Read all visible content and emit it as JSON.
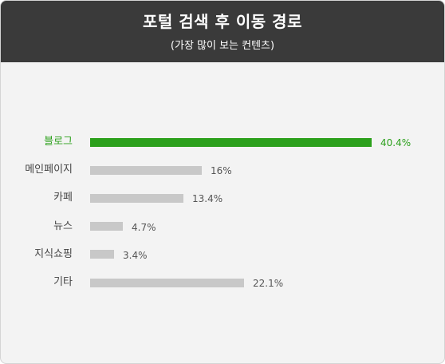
{
  "header": {
    "title": "포털 검색 후 이동 경로",
    "subtitle": "(가장 많이 보는 컨텐츠)"
  },
  "colors": {
    "highlight": "#2ca01c",
    "bar": "#c8c8c8",
    "label": "#444444",
    "value": "#555555"
  },
  "chart_data": {
    "type": "bar",
    "orientation": "horizontal",
    "title": "포털 검색 후 이동 경로",
    "subtitle": "(가장 많이 보는 컨텐츠)",
    "categories": [
      "블로그",
      "메인페이지",
      "카페",
      "뉴스",
      "지식쇼핑",
      "기타"
    ],
    "values": [
      40.4,
      16,
      13.4,
      4.7,
      3.4,
      22.1
    ],
    "value_labels": [
      "40.4%",
      "16%",
      "13.4%",
      "4.7%",
      "3.4%",
      "22.1%"
    ],
    "highlight_index": 0,
    "unit": "%",
    "xlim": [
      0,
      40.4
    ],
    "grid": false,
    "legend": "none"
  }
}
